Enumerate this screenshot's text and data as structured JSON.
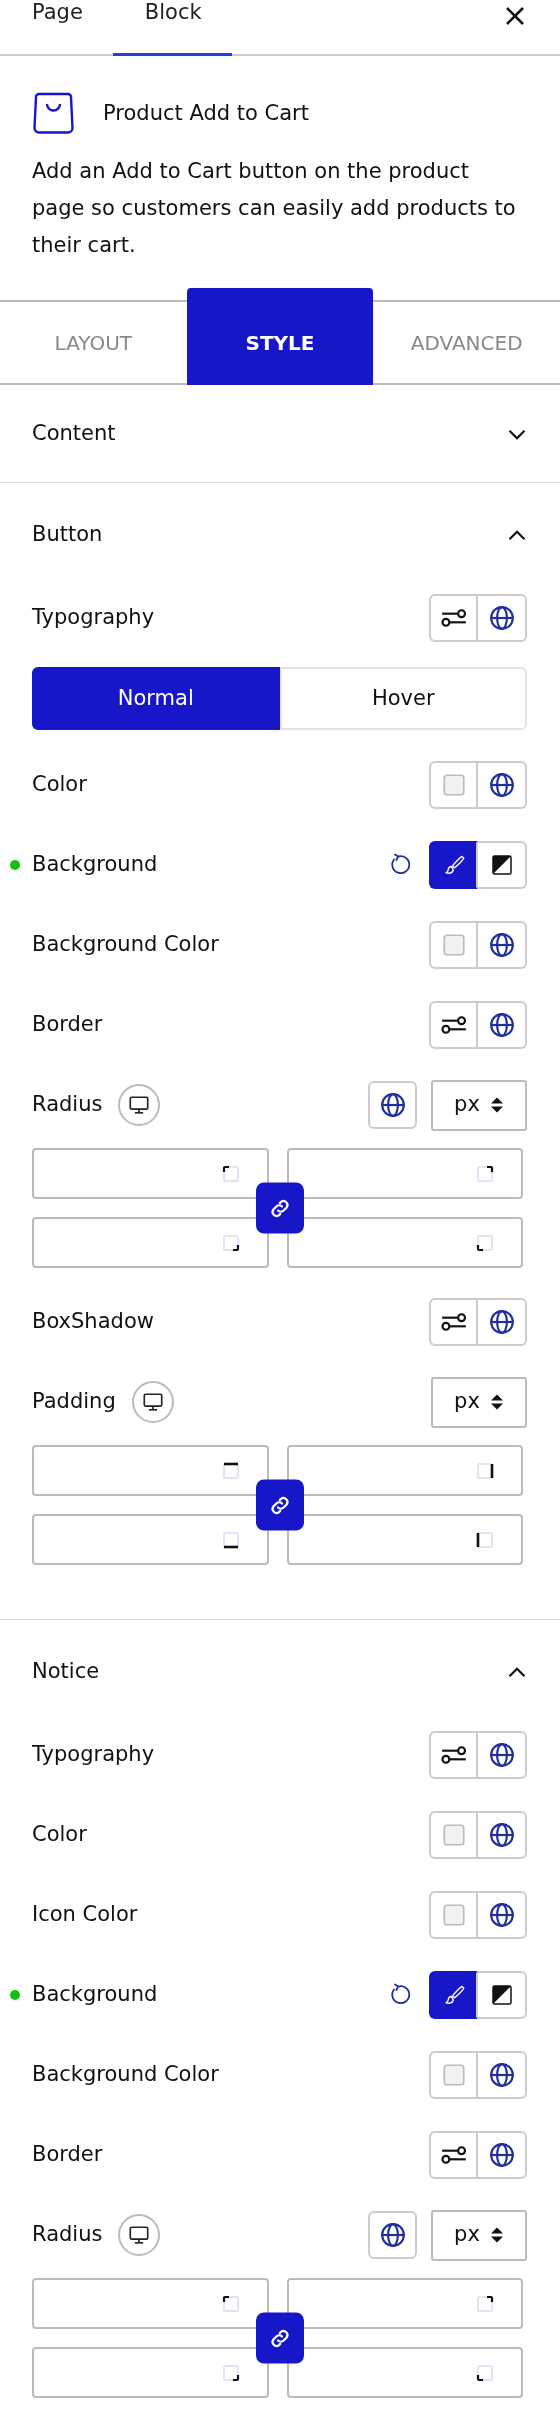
{
  "header_tabs": [
    {
      "label": "Page",
      "selected": false
    },
    {
      "label": "Block",
      "selected": true
    }
  ],
  "block": {
    "title": "Product Add to Cart",
    "description": "Add an Add to Cart button on the product page so customers can easily add products to their cart."
  },
  "style_tabs": [
    {
      "label": "LAYOUT",
      "selected": false
    },
    {
      "label": "STYLE",
      "selected": true
    },
    {
      "label": "ADVANCED",
      "selected": false
    }
  ],
  "sections": [
    {
      "title": "Content",
      "expanded": false
    },
    {
      "title": "Button",
      "expanded": true,
      "controls": [
        {
          "kind": "settings",
          "label": "Typography"
        },
        {
          "kind": "state_toggle",
          "options": [
            {
              "label": "Normal",
              "selected": true
            },
            {
              "label": "Hover",
              "selected": false
            }
          ]
        },
        {
          "kind": "color",
          "label": "Color"
        },
        {
          "kind": "background",
          "label": "Background",
          "modified": true,
          "modes": [
            {
              "kind": "brush",
              "selected": true
            },
            {
              "kind": "gradient",
              "selected": false
            }
          ]
        },
        {
          "kind": "color",
          "label": "Background Color"
        },
        {
          "kind": "settings",
          "label": "Border"
        },
        {
          "kind": "dimensions",
          "label": "Radius",
          "global_button": true,
          "unit": "px",
          "linked": true,
          "fields": [
            {
              "kind": "corner_top_left"
            },
            {
              "kind": "corner_top_right"
            },
            {
              "kind": "corner_bottom_right"
            },
            {
              "kind": "corner_bottom_left"
            }
          ]
        },
        {
          "kind": "settings",
          "label": "BoxShadow"
        },
        {
          "kind": "dimensions",
          "label": "Padding",
          "global_button": false,
          "unit": "px",
          "linked": true,
          "fields": [
            {
              "kind": "side_top"
            },
            {
              "kind": "side_right"
            },
            {
              "kind": "side_bottom"
            },
            {
              "kind": "side_left"
            }
          ]
        }
      ]
    },
    {
      "title": "Notice",
      "expanded": true,
      "controls": [
        {
          "kind": "settings",
          "label": "Typography"
        },
        {
          "kind": "color",
          "label": "Color"
        },
        {
          "kind": "color",
          "label": "Icon Color"
        },
        {
          "kind": "background",
          "label": "Background",
          "modified": true,
          "modes": [
            {
              "kind": "brush",
              "selected": true
            },
            {
              "kind": "gradient",
              "selected": false
            }
          ]
        },
        {
          "kind": "color",
          "label": "Background Color"
        },
        {
          "kind": "settings",
          "label": "Border"
        },
        {
          "kind": "dimensions",
          "label": "Radius",
          "global_button": true,
          "unit": "px",
          "linked": true,
          "fields": [
            {
              "kind": "corner_top_left"
            },
            {
              "kind": "corner_top_right"
            },
            {
              "kind": "corner_bottom_right"
            },
            {
              "kind": "corner_bottom_left"
            }
          ]
        }
      ]
    }
  ]
}
